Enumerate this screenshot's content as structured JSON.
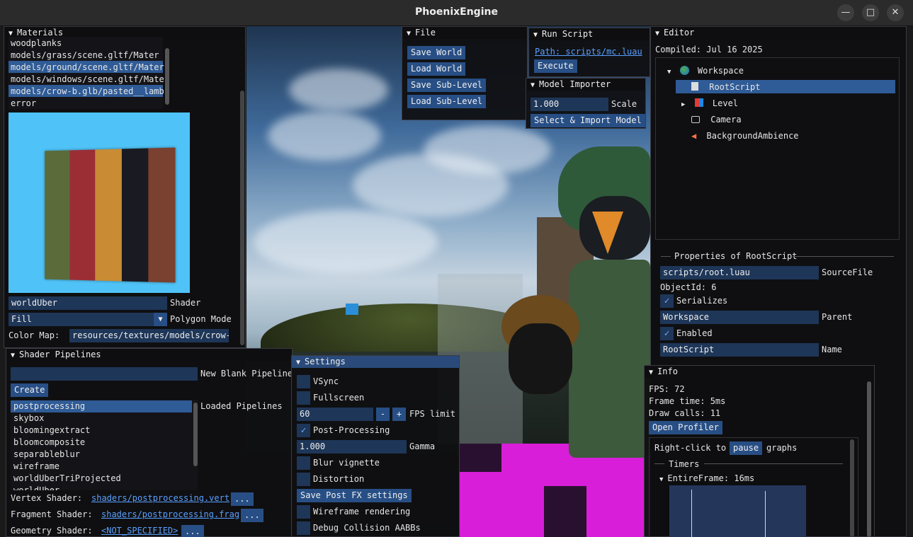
{
  "window": {
    "title": "PhoenixEngine",
    "min": "—",
    "max": "□",
    "close": "✕"
  },
  "materials": {
    "header": "Materials",
    "items": [
      "woodplanks",
      "models/grass/scene.gltf/Mater",
      "models/ground/scene.gltf/Mater",
      "models/windows/scene.gltf/Mate",
      "models/crow-b.glb/pasted__lamb",
      "error"
    ],
    "shader_value": "worldUber",
    "shader_label": "Shader",
    "polygon_value": "Fill",
    "polygon_label": "Polygon Mode",
    "colormap_label": "Color Map:",
    "colormap_value": "resources/textures/models/crow-b",
    "preview_colors": [
      "#5b6b3a",
      "#9b2e35",
      "#c98b34",
      "#1a1b22",
      "#7a4030"
    ]
  },
  "shader_pipelines": {
    "header": "Shader Pipelines",
    "new_label": "New Blank Pipeline",
    "new_value": "",
    "create": "Create",
    "loaded_label": "Loaded Pipelines",
    "items": [
      "postprocessing",
      "skybox",
      "bloomingextract",
      "bloomcomposite",
      "separableblur",
      "wireframe",
      "worldUberTriProjected",
      "worldUber"
    ],
    "vertex_label": "Vertex Shader:",
    "vertex_value": "shaders/postprocessing.vert",
    "fragment_label": "Fragment Shader:",
    "fragment_value": "shaders/postprocessing.frag",
    "geometry_label": "Geometry Shader:",
    "geometry_value": "<NOT_SPECIFIED>",
    "dots": "..."
  },
  "file": {
    "header": "File",
    "buttons": [
      "Save World",
      "Load World",
      "Save Sub-Level",
      "Load Sub-Level"
    ]
  },
  "run_script": {
    "header": "Run Script",
    "path": "Path: scripts/mc.luau",
    "execute": "Execute"
  },
  "model_importer": {
    "header": "Model Importer",
    "scale_value": "1.000",
    "scale_label": "Scale",
    "import": "Select & Import Model"
  },
  "settings": {
    "header": "Settings",
    "vsync": "VSync",
    "fullscreen": "Fullscreen",
    "fps_value": "60",
    "minus": "-",
    "plus": "+",
    "fps_label": "FPS limit",
    "postprocessing": "Post-Processing",
    "gamma_value": "1.000",
    "gamma_label": "Gamma",
    "blur": "Blur vignette",
    "distortion": "Distortion",
    "save_fx": "Save Post FX settings",
    "wireframe": "Wireframe rendering",
    "collision": "Debug Collision AABBs"
  },
  "editor": {
    "header": "Editor",
    "compiled": "Compiled: Jul 16 2025",
    "tree": {
      "workspace": "Workspace",
      "rootscript": "RootScript",
      "level": "Level",
      "camera": "Camera",
      "ambience": "BackgroundAmbience"
    }
  },
  "properties": {
    "header": "Properties of RootScript",
    "sourcefile_value": "scripts/root.luau",
    "sourcefile_label": "SourceFile",
    "objectid": "ObjectId: 6",
    "serializes": "Serializes",
    "parent_value": "Workspace",
    "parent_label": "Parent",
    "enabled": "Enabled",
    "name_value": "RootScript",
    "name_label": "Name",
    "check": "✓"
  },
  "info": {
    "header": "Info",
    "fps": "FPS: 72",
    "frame_time": "Frame time: 5ms",
    "draw_calls": "Draw calls: 11",
    "profiler": "Open Profiler",
    "rightclick": "Right-click to",
    "pause": "pause",
    "graphs": "graphs",
    "timers": "Timers",
    "entire": "EntireFrame: 16ms"
  }
}
